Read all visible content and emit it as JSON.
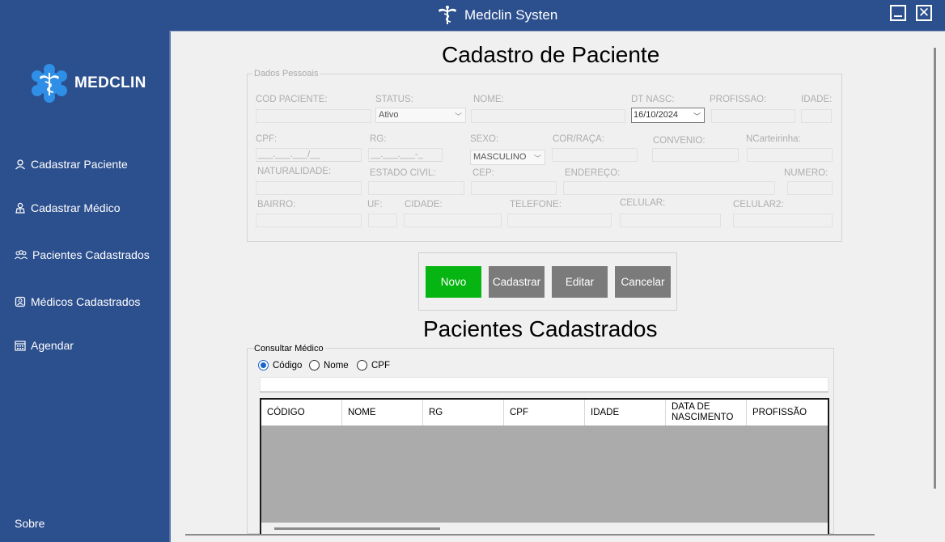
{
  "window": {
    "title": "Medclin Systen",
    "app_icon": "caduceus-icon",
    "minimize_icon": "minimize-icon",
    "close_symbol": "✕"
  },
  "sidebar": {
    "logo_text": "MEDCLIN",
    "items": [
      {
        "label": "Cadastrar Paciente",
        "icon": "person-icon"
      },
      {
        "label": "Cadastrar Médico",
        "icon": "doctor-icon"
      },
      {
        "label": "Pacientes Cadastrados",
        "icon": "people-icon"
      },
      {
        "label": "Médicos Cadastrados",
        "icon": "doctors-list-icon"
      },
      {
        "label": "Agendar",
        "icon": "calendar-icon"
      }
    ],
    "footer": "Sobre"
  },
  "form": {
    "title": "Cadastro de Paciente",
    "group_legend": "Dados Pessoais",
    "labels": {
      "cod_paciente": "COD PACIENTE:",
      "status": "STATUS:",
      "nome": "NOME:",
      "dt_nasc": "DT NASC:",
      "profissao": "PROFISSAO:",
      "idade": "IDADE:",
      "cpf": "CPF:",
      "rg": "RG:",
      "sexo": "SEXO:",
      "cor_raca": "COR/RAÇA:",
      "convenio": "CONVENIO:",
      "ncarteirinha": "NCarteirinha:",
      "naturalidade": "NATURALIDADE:",
      "estado_civil": "ESTADO CIVIL:",
      "cep": "CEP:",
      "endereco": "ENDEREÇO:",
      "numero": "NUMERO:",
      "bairro": "BAIRRO:",
      "uf": "UF:",
      "cidade": "CIDADE:",
      "telefone": "TELEFONE:",
      "celular": "CELULAR:",
      "celular2": "CELULAR2:"
    },
    "values": {
      "status": "Ativo",
      "dt_nasc": "16/10/2024",
      "cpf_mask": "___.___.___/__",
      "rg_mask": "__.___.___-_",
      "sexo": "MASCULINO"
    }
  },
  "buttons": {
    "novo": "Novo",
    "cadastrar": "Cadastrar",
    "editar": "Editar",
    "cancelar": "Cancelar",
    "novo_color": "#06b512",
    "gray_color": "#7b7b7b"
  },
  "list": {
    "title": "Pacientes Cadastrados",
    "search_legend": "Consultar Médico",
    "radio_options": [
      "Código",
      "Nome",
      "CPF"
    ],
    "selected_option": "Código",
    "search_value": "",
    "columns": [
      "CÓDIGO",
      "NOME",
      "RG",
      "CPF",
      "IDADE",
      "DATA DE NASCIMENTO",
      "PROFISSÃO"
    ],
    "rows": []
  }
}
